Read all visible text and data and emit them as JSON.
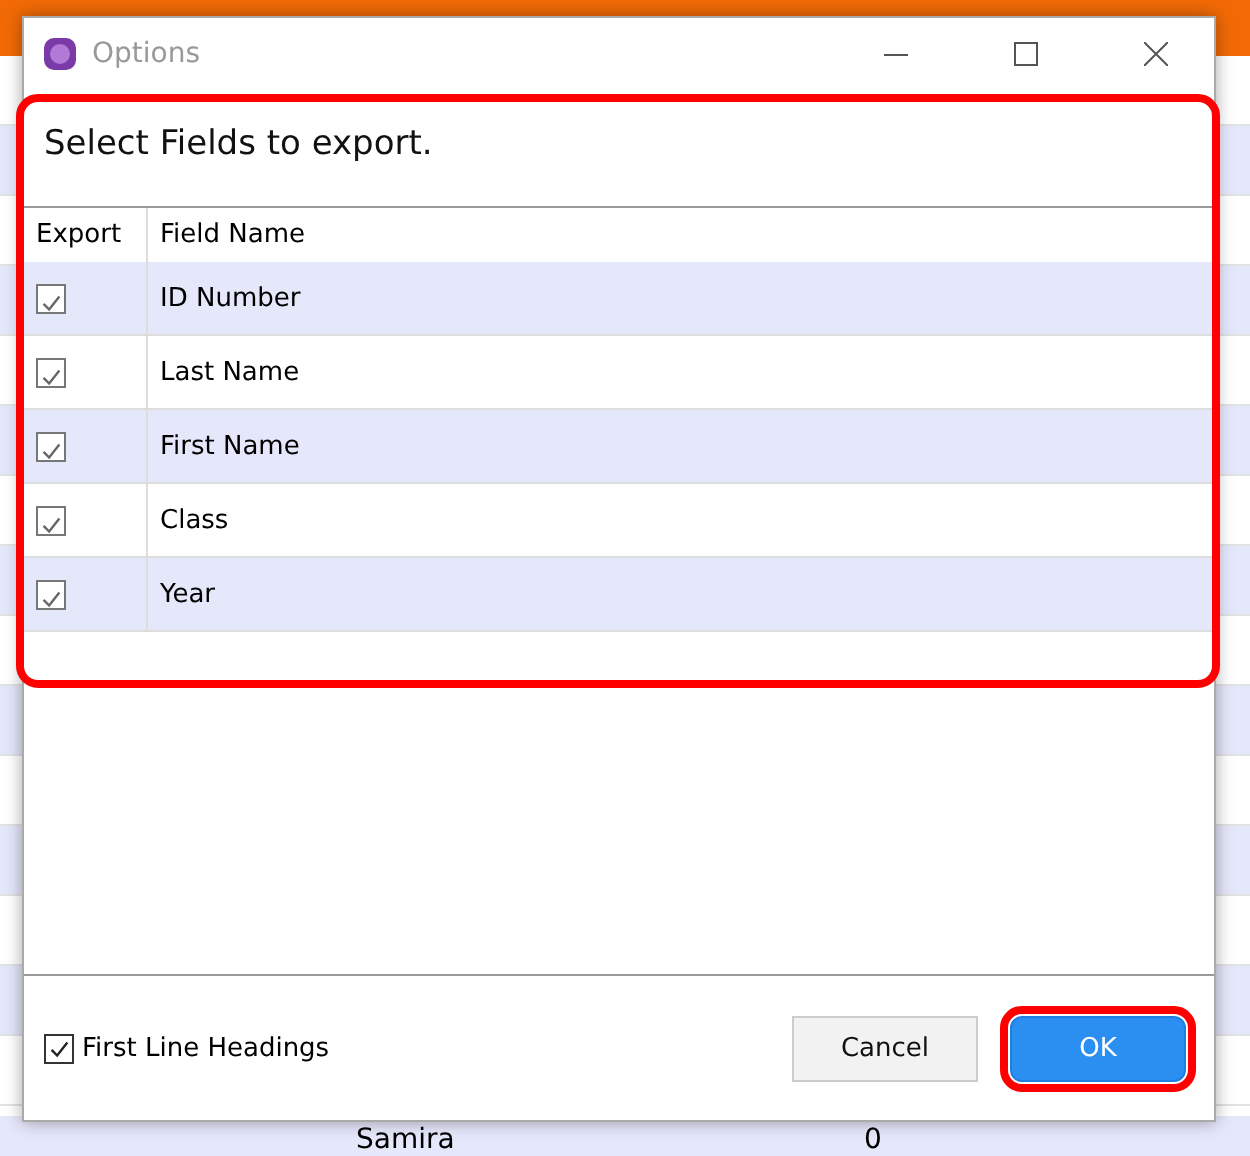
{
  "background": {
    "cells": [
      "Samira",
      "0"
    ]
  },
  "window": {
    "title": "Options"
  },
  "heading": "Select Fields to export.",
  "table": {
    "highlighted": true,
    "columns": [
      "Export",
      "Field Name"
    ],
    "rows": [
      {
        "checked": true,
        "name": "ID Number"
      },
      {
        "checked": true,
        "name": "Last Name"
      },
      {
        "checked": true,
        "name": "First Name"
      },
      {
        "checked": true,
        "name": "Class"
      },
      {
        "checked": true,
        "name": "Year"
      }
    ]
  },
  "first_line_headings": {
    "label": "First Line Headings",
    "checked": true
  },
  "buttons": [
    {
      "label": "Cancel",
      "kind": "secondary",
      "highlighted": false
    },
    {
      "label": "OK",
      "kind": "primary",
      "highlighted": true
    }
  ]
}
